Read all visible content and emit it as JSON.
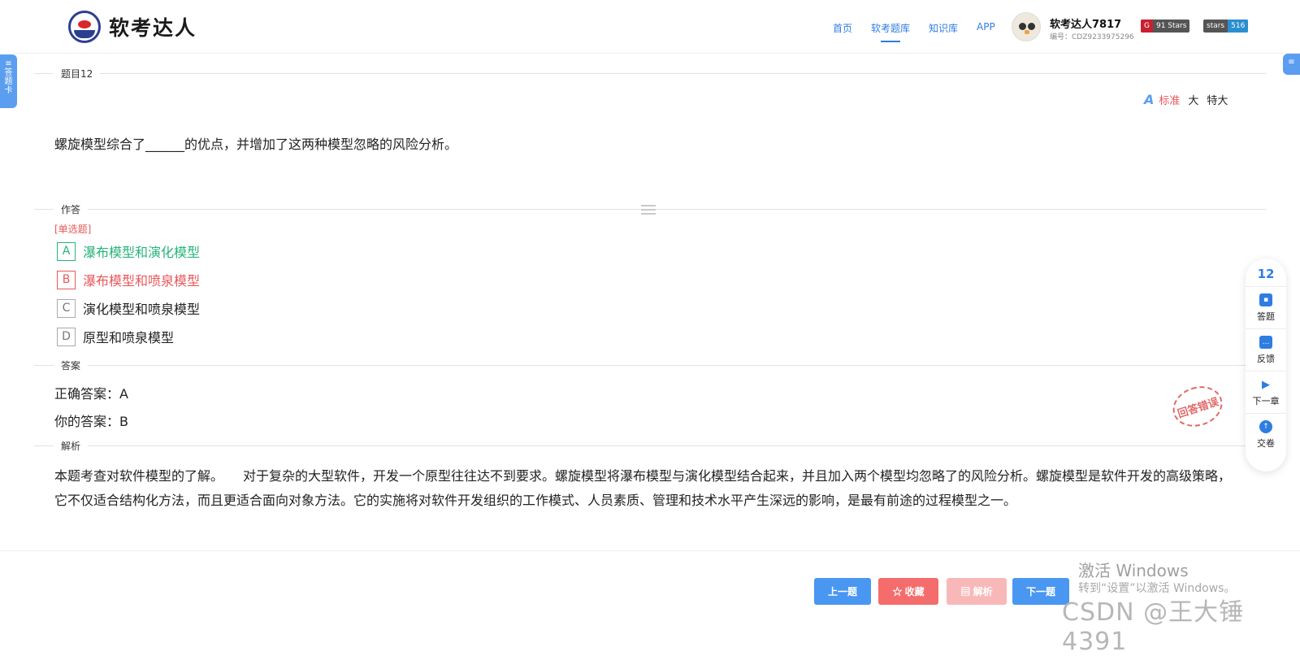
{
  "header": {
    "logo_text": "软考达人",
    "nav": [
      "首页",
      "软考题库",
      "知识库",
      "APP"
    ],
    "active_nav": 1,
    "user": {
      "name": "软考达人7817",
      "id": "编号：CDZ9233975296"
    },
    "badges": [
      {
        "left": "G",
        "right": "91 Stars"
      },
      {
        "left": "stars",
        "right": "516"
      }
    ]
  },
  "side": {
    "left_tab": [
      "≡",
      "答",
      "题",
      "卡"
    ],
    "right_tab": "≡"
  },
  "question": {
    "section_label": "题目12",
    "font_sizes": {
      "icon": "A",
      "options": [
        "标准",
        "大",
        "特大"
      ],
      "active": 0
    },
    "text": "螺旋模型综合了______的优点，并增加了这两种模型忽略的风险分析。"
  },
  "answer_area": {
    "section_label": "作答",
    "type": "[单选题]",
    "options": [
      {
        "key": "A",
        "text": "瀑布模型和演化模型",
        "state": "correct"
      },
      {
        "key": "B",
        "text": "瀑布模型和喷泉模型",
        "state": "wrong"
      },
      {
        "key": "C",
        "text": "演化模型和喷泉模型",
        "state": "normal"
      },
      {
        "key": "D",
        "text": "原型和喷泉模型",
        "state": "normal"
      }
    ]
  },
  "answer": {
    "section_label": "答案",
    "correct": "正确答案：A",
    "yours": "你的答案：B",
    "stamp": "回答错误"
  },
  "analysis": {
    "section_label": "解析",
    "text": "本题考查对软件模型的了解。　　对于复杂的大型软件，开发一个原型往往达不到要求。螺旋模型将瀑布模型与演化模型结合起来，并且加入两个模型均忽略了的风险分析。螺旋模型是软件开发的高级策略，它不仅适合结构化方法，而且更适合面向对象方法。它的实施将对软件开发组织的工作模式、人员素质、管理和技术水平产生深远的影响，是最有前途的过程模型之一。"
  },
  "right_panel": {
    "number": "12",
    "items": [
      {
        "icon": "▪",
        "label": "答题"
      },
      {
        "icon": "…",
        "label": "反馈"
      },
      {
        "icon": "▶",
        "label": "下一章"
      },
      {
        "icon": "↑",
        "label": "交卷"
      }
    ]
  },
  "footer": {
    "prev": "上一题",
    "fav": "☆ 收藏",
    "explain": "▤ 解析",
    "next": "下一题"
  },
  "watermark": {
    "line1": "激活 Windows",
    "line2": "转到“设置”以激活 Windows。",
    "line3": "CSDN @王大锤4391"
  },
  "colors": {
    "primary": "#4a97f2",
    "correct": "#27b47a",
    "wrong": "#e8585a"
  }
}
